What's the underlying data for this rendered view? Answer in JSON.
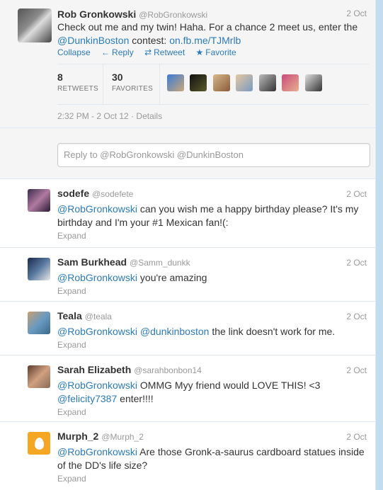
{
  "main_tweet": {
    "name": "Rob Gronkowski",
    "handle": "@RobGronkowski",
    "date": "2 Oct",
    "text_before": "Check out me and my twin! Haha. For a chance 2 meet us, enter the ",
    "mention": "@DunkinBoston",
    "text_mid": " contest: ",
    "url": "on.fb.me/TJMrlb",
    "actions": {
      "collapse": "Collapse",
      "reply": "Reply",
      "retweet": "Retweet",
      "favorite": "Favorite"
    },
    "retweets_count": "8",
    "retweets_label": "RETWEETS",
    "favorites_count": "30",
    "favorites_label": "FAVORITES",
    "timestamp": "2:32 PM - 2 Oct 12",
    "details": "Details"
  },
  "reply_box": {
    "placeholder": "Reply to @RobGronkowski @DunkinBoston"
  },
  "replies": [
    {
      "name": "sodefe",
      "handle": "@sodefete",
      "date": "2 Oct",
      "mention": "@RobGronkowski",
      "text": " can you wish me a happy birthday please? It's my birthday and I'm your #1 Mexican fan!(:",
      "expand": "Expand"
    },
    {
      "name": "Sam Burkhead",
      "handle": "@Samm_dunkk",
      "date": "2 Oct",
      "mention": "@RobGronkowski",
      "text": " you're amazing",
      "expand": "Expand"
    },
    {
      "name": "Teala",
      "handle": "@teala",
      "date": "2 Oct",
      "mention": "@RobGronkowski",
      "mention2": "@dunkinboston",
      "text": " the link doesn't work for me.",
      "expand": "Expand"
    },
    {
      "name": "Sarah Elizabeth",
      "handle": "@sarahbonbon14",
      "date": "2 Oct",
      "mention": "@RobGronkowski",
      "text": " OMMG Myy friend would LOVE THIS! <3 ",
      "mention2": "@felicity7387",
      "text2": " enter!!!!",
      "expand": "Expand"
    },
    {
      "name": "Murph_2",
      "handle": "@Murph_2",
      "date": "2 Oct",
      "mention": "@RobGronkowski",
      "text": " Are those Gronk-a-saurus cardboard statues inside of the DD's life size?",
      "expand": "Expand"
    }
  ],
  "colors": {
    "link": "#2b7bb9",
    "background": "#c0deed"
  }
}
